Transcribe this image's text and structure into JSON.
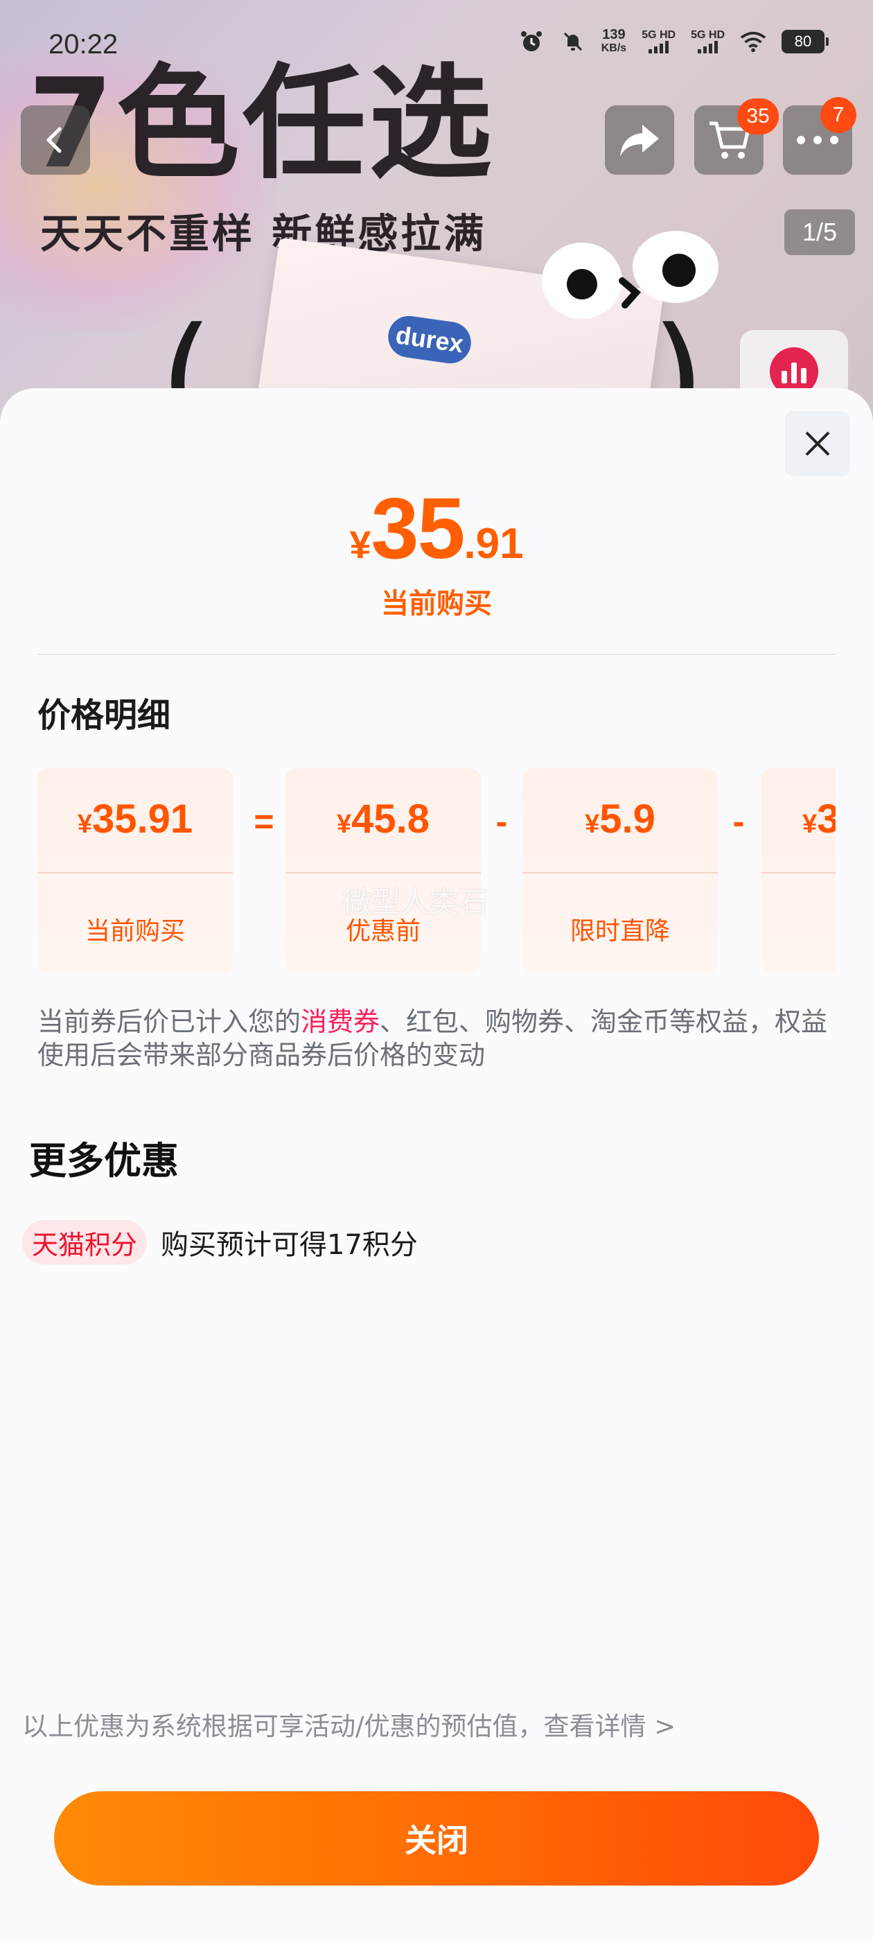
{
  "status_bar": {
    "time": "20:22",
    "net_speed_value": "139",
    "net_speed_unit": "KB/s",
    "sim1_label": "5G HD",
    "sim2_label": "5G HD",
    "battery": "80"
  },
  "banner": {
    "title": "7色任选",
    "subtitle": "天天不重样  新鲜感拉满",
    "cart_badge": "35",
    "more_badge": "7",
    "page_indicator": "1/5",
    "product_logo": "durex"
  },
  "sheet": {
    "price_symbol": "¥",
    "price_integer": "35",
    "price_decimal": ".91",
    "price_caption": "当前购买",
    "section_title": "价格明细",
    "breakdown": [
      {
        "value_symbol": "¥",
        "value": "35.91",
        "label": "当前购买"
      },
      {
        "value_symbol": "¥",
        "value": "45.8",
        "label": "优惠前"
      },
      {
        "value_symbol": "¥",
        "value": "5.9",
        "label": "限时直降"
      },
      {
        "value_symbol": "¥",
        "value": "3",
        "label": ""
      }
    ],
    "operators": [
      "=",
      "-",
      "-"
    ],
    "watermark": "微型人类石",
    "note_before": "当前券后价已计入您的",
    "note_highlight": "消费券",
    "note_after": "、红包、购物券、淘金币等权益，权益使用后会带来部分商品券后价格的变动",
    "more_title": "更多优惠",
    "points_tag": "天猫积分",
    "points_text": "购买预计可得17积分",
    "disclaimer": "以上优惠为系统根据可享活动/优惠的预估值，查看详情 >",
    "close_label": "关闭"
  },
  "colors": {
    "accent": "#ff5f00",
    "highlight": "#ff1f5a",
    "tag_bg": "#ffe6e8",
    "button_start": "#ff8a06",
    "button_end": "#ff4a0a"
  },
  "icons": [
    "alarm-icon",
    "mute-icon",
    "wifi-icon",
    "back-icon",
    "share-icon",
    "cart-icon",
    "more-icon",
    "chart-icon",
    "close-icon"
  ]
}
